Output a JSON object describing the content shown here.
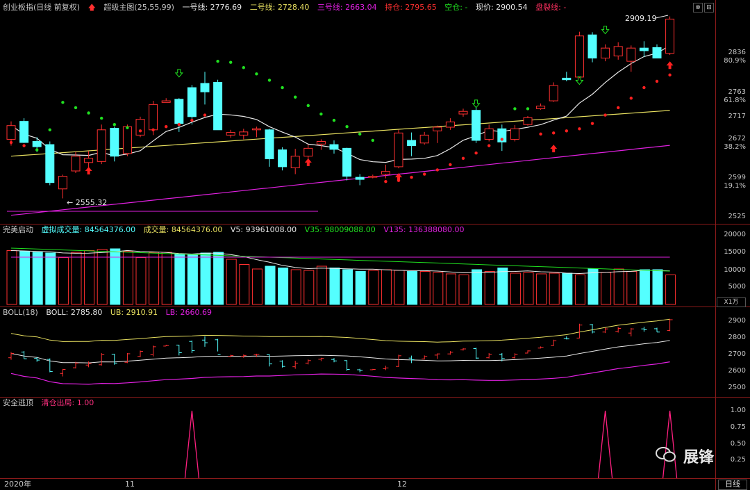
{
  "header_main": {
    "index": "创业板指(日线 前复权)",
    "indicator": "超级主图(25,55,99)",
    "line1": "一号线: 2776.69",
    "line2": "二号线: 2728.40",
    "line3": "三号线: 2663.04",
    "hold": "持仓: 2795.65",
    "empty": "空仓: -",
    "price": "现价: 2900.54",
    "crack": "盘裂线: -"
  },
  "header_vol": {
    "name": "完美启动",
    "virt": "虚拟成交量: 84564376.00",
    "vol": "成交量: 84564376.00",
    "v5": "V5: 93961008.00",
    "v35": "V35: 98009088.00",
    "v135": "V135: 136388080.00"
  },
  "header_boll": {
    "name": "BOLL(18)",
    "boll": "BOLL: 2785.80",
    "ub": "UB: 2910.91",
    "lb": "LB: 2660.69"
  },
  "header_safe": {
    "name": "安全逃顶",
    "val": "清仓出局: 1.00"
  },
  "main_axis": [
    "2836",
    "80.9%",
    "2763",
    "61.8%",
    "2717",
    "2672",
    "38.2%",
    "2599",
    "19.1%",
    "2525"
  ],
  "vol_axis": [
    "20000",
    "15000",
    "10000",
    "5000"
  ],
  "vol_btn": "X1万",
  "boll_axis": [
    "2900",
    "2800",
    "2700",
    "2600",
    "2500"
  ],
  "safe_axis": [
    "1.00",
    "0.75",
    "0.50",
    "0.25"
  ],
  "date_labels": [
    "2020年",
    "11",
    "12"
  ],
  "period_btn": "日线",
  "window_buttons": [
    "⊗",
    "⊟"
  ],
  "watermark": "展锋",
  "colors": {
    "up": "#ff3030",
    "down": "#54ffff",
    "line1": "#e8e8e8",
    "line2": "#e8e060",
    "line3": "#e020e0",
    "dots": "#20e020"
  },
  "chart_data": {
    "type": "candlestick",
    "x": "2020-10 to 2020-12 daily bars",
    "annotations": {
      "high": "2909.19",
      "low": "2555.32"
    },
    "candles": [
      {
        "o": 2672,
        "h": 2706,
        "l": 2660,
        "c": 2698
      },
      {
        "o": 2706,
        "h": 2712,
        "l": 2665,
        "c": 2666
      },
      {
        "o": 2668,
        "h": 2676,
        "l": 2648,
        "c": 2658
      },
      {
        "o": 2662,
        "h": 2668,
        "l": 2585,
        "c": 2590
      },
      {
        "o": 2578,
        "h": 2605,
        "l": 2560,
        "c": 2602
      },
      {
        "o": 2612,
        "h": 2648,
        "l": 2608,
        "c": 2640
      },
      {
        "o": 2628,
        "h": 2650,
        "l": 2615,
        "c": 2636
      },
      {
        "o": 2630,
        "h": 2700,
        "l": 2625,
        "c": 2690
      },
      {
        "o": 2693,
        "h": 2696,
        "l": 2630,
        "c": 2640
      },
      {
        "o": 2645,
        "h": 2700,
        "l": 2640,
        "c": 2696
      },
      {
        "o": 2680,
        "h": 2715,
        "l": 2676,
        "c": 2710
      },
      {
        "o": 2690,
        "h": 2745,
        "l": 2680,
        "c": 2738
      },
      {
        "o": 2742,
        "h": 2750,
        "l": 2742,
        "c": 2745
      },
      {
        "o": 2748,
        "h": 2750,
        "l": 2686,
        "c": 2702
      },
      {
        "o": 2770,
        "h": 2775,
        "l": 2700,
        "c": 2715
      },
      {
        "o": 2778,
        "h": 2800,
        "l": 2738,
        "c": 2762
      },
      {
        "o": 2780,
        "h": 2785,
        "l": 2710,
        "c": 2690
      },
      {
        "o": 2680,
        "h": 2690,
        "l": 2675,
        "c": 2685
      },
      {
        "o": 2680,
        "h": 2692,
        "l": 2672,
        "c": 2686
      },
      {
        "o": 2690,
        "h": 2696,
        "l": 2676,
        "c": 2692
      },
      {
        "o": 2690,
        "h": 2692,
        "l": 2620,
        "c": 2635
      },
      {
        "o": 2652,
        "h": 2657,
        "l": 2613,
        "c": 2620
      },
      {
        "o": 2618,
        "h": 2654,
        "l": 2606,
        "c": 2640
      },
      {
        "o": 2640,
        "h": 2662,
        "l": 2632,
        "c": 2655
      },
      {
        "o": 2663,
        "h": 2672,
        "l": 2652,
        "c": 2668
      },
      {
        "o": 2662,
        "h": 2670,
        "l": 2645,
        "c": 2653
      },
      {
        "o": 2655,
        "h": 2656,
        "l": 2594,
        "c": 2602
      },
      {
        "o": 2600,
        "h": 2606,
        "l": 2585,
        "c": 2596
      },
      {
        "o": 2600,
        "h": 2605,
        "l": 2598,
        "c": 2602
      },
      {
        "o": 2606,
        "h": 2624,
        "l": 2598,
        "c": 2611
      },
      {
        "o": 2620,
        "h": 2690,
        "l": 2617,
        "c": 2684
      },
      {
        "o": 2670,
        "h": 2685,
        "l": 2640,
        "c": 2660
      },
      {
        "o": 2665,
        "h": 2686,
        "l": 2662,
        "c": 2680
      },
      {
        "o": 2688,
        "h": 2698,
        "l": 2665,
        "c": 2695
      },
      {
        "o": 2695,
        "h": 2712,
        "l": 2690,
        "c": 2705
      },
      {
        "o": 2720,
        "h": 2730,
        "l": 2715,
        "c": 2725
      },
      {
        "o": 2727,
        "h": 2732,
        "l": 2665,
        "c": 2670
      },
      {
        "o": 2672,
        "h": 2700,
        "l": 2668,
        "c": 2692
      },
      {
        "o": 2692,
        "h": 2700,
        "l": 2650,
        "c": 2667
      },
      {
        "o": 2672,
        "h": 2699,
        "l": 2668,
        "c": 2692
      },
      {
        "o": 2700,
        "h": 2716,
        "l": 2698,
        "c": 2713
      },
      {
        "o": 2730,
        "h": 2740,
        "l": 2728,
        "c": 2735
      },
      {
        "o": 2745,
        "h": 2780,
        "l": 2743,
        "c": 2774
      },
      {
        "o": 2788,
        "h": 2800,
        "l": 2782,
        "c": 2785
      },
      {
        "o": 2790,
        "h": 2876,
        "l": 2788,
        "c": 2868
      },
      {
        "o": 2870,
        "h": 2875,
        "l": 2818,
        "c": 2826
      },
      {
        "o": 2826,
        "h": 2852,
        "l": 2820,
        "c": 2845
      },
      {
        "o": 2830,
        "h": 2856,
        "l": 2823,
        "c": 2848
      },
      {
        "o": 2820,
        "h": 2850,
        "l": 2800,
        "c": 2845
      },
      {
        "o": 2845,
        "h": 2858,
        "l": 2828,
        "c": 2840
      },
      {
        "o": 2846,
        "h": 2852,
        "l": 2826,
        "c": 2826
      },
      {
        "o": 2835,
        "h": 2905,
        "l": 2832,
        "c": 2900
      }
    ],
    "volume": [
      15.5,
      15.3,
      15.0,
      14.8,
      13.5,
      15.0,
      15.5,
      15.8,
      16.0,
      15.3,
      13.5,
      15.0,
      15.0,
      14.5,
      14.5,
      14.8,
      15.0,
      13.0,
      11.5,
      10.2,
      11.0,
      10.5,
      10.0,
      9.8,
      11.0,
      10.5,
      10.0,
      9.5,
      9.8,
      10.0,
      9.8,
      9.5,
      9.5,
      9.2,
      8.8,
      8.5,
      10.0,
      9.5,
      10.5,
      9.0,
      9.2,
      8.8,
      9.0,
      9.0,
      8.5,
      10.2,
      9.2,
      10.2,
      9.5,
      10.0,
      10.0,
      8.5
    ],
    "boll_mid_range": [
      2636,
      2785.8
    ],
    "boll_ub": 2910.91,
    "boll_lb": 2660.69,
    "safe_signal_spikes": [
      14,
      46,
      51
    ]
  }
}
